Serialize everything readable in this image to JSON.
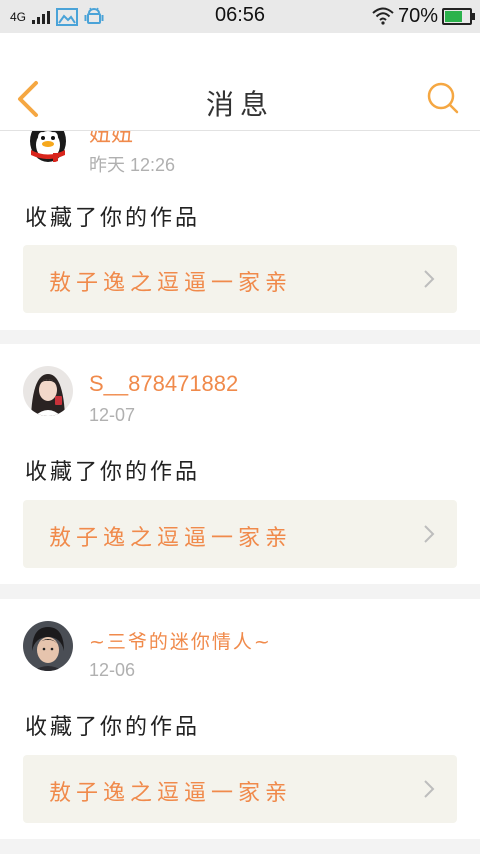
{
  "status_bar": {
    "network": "4G",
    "time": "06:56",
    "battery_text": "70%",
    "battery_level": 0.7,
    "battery_color": "#2bb24c"
  },
  "header": {
    "title": "消息",
    "back_icon": "chevron-left-icon",
    "search_icon": "search-icon",
    "accent_color": "#f5a742"
  },
  "messages": [
    {
      "username": "妞妞",
      "time": "昨天 12:26",
      "action": "收藏了你的作品",
      "work_title": "敖子逸之逗逼一家亲",
      "avatar": "penguin-avatar"
    },
    {
      "username": "S__878471882",
      "time": "12-07",
      "action": "收藏了你的作品",
      "work_title": "敖子逸之逗逼一家亲",
      "avatar": "girl-photo-avatar"
    },
    {
      "username": "~三爷的迷你情人~",
      "time": "12-06",
      "action": "收藏了你的作品",
      "work_title": "敖子逸之逗逼一家亲",
      "avatar": "boy-photo-avatar"
    }
  ],
  "colors": {
    "username": "#f08a4b",
    "work_link_bg": "#f4f3ec",
    "background": "#f3f3f3"
  }
}
